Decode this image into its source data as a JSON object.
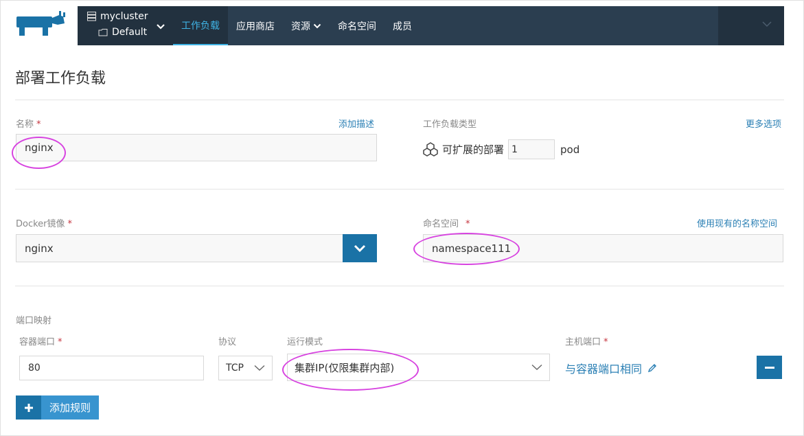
{
  "header": {
    "cluster_name": "mycluster",
    "project_name": "Default",
    "nav": [
      {
        "label": "工作负载",
        "active": true
      },
      {
        "label": "应用商店"
      },
      {
        "label": "资源"
      },
      {
        "label": "命名空间"
      },
      {
        "label": "成员"
      }
    ]
  },
  "page": {
    "title": "部署工作负载"
  },
  "form": {
    "name_label": "名称",
    "required_mark": "*",
    "add_description": "添加描述",
    "name_value": "nginx",
    "workload_type_label": "工作负载类型",
    "more_options": "更多选项",
    "scalable_label": "可扩展的部署",
    "scale_value": "1",
    "scale_unit": "pod",
    "docker_image_label": "Docker镜像",
    "docker_image_value": "nginx",
    "namespace_label": "命名空间",
    "use_existing_namespace": "使用现有的名称空间",
    "namespace_value": "namespace111",
    "port_mapping_label": "端口映射",
    "container_port_label": "容器端口",
    "protocol_label": "协议",
    "run_mode_label": "运行模式",
    "host_port_label": "主机端口",
    "container_port_value": "80",
    "protocol_value": "TCP",
    "run_mode_value": "集群IP(仅限集群内部)",
    "host_port_same": "与容器端口相同",
    "add_rule": "添加规则"
  },
  "colors": {
    "nav_bg": "#2b3e50",
    "nav_dark": "#22313f",
    "accent": "#3fb4e6",
    "primary_button": "#1a72a6",
    "link": "#2a7fb4",
    "highlight_circle": "#d743e0"
  }
}
